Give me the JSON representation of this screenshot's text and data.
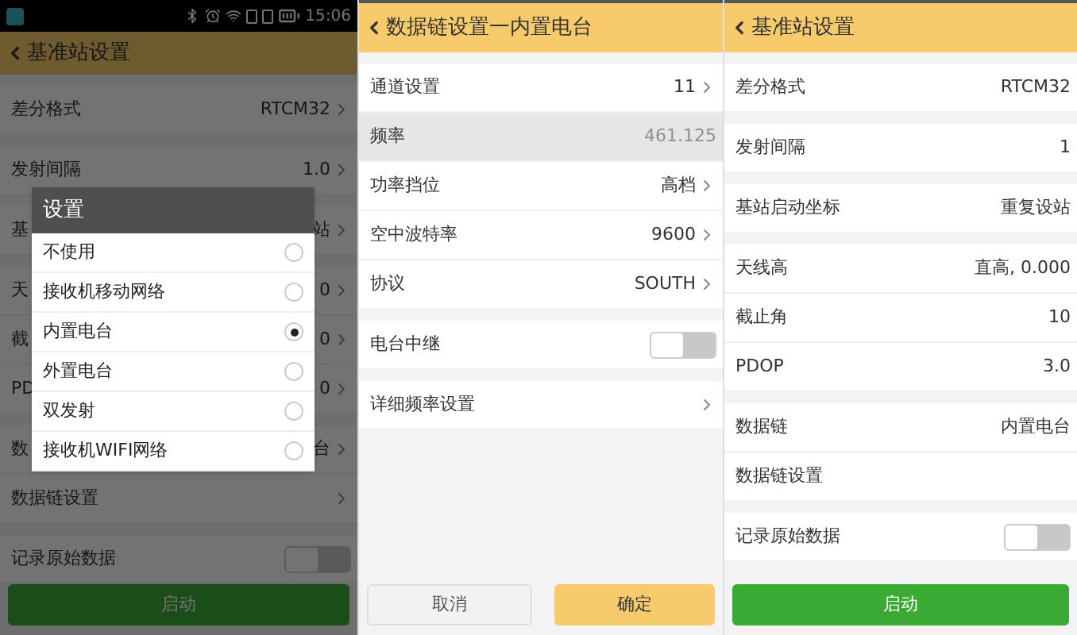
{
  "left_screen": {
    "status_bar": {
      "time": "15:06"
    },
    "title": "基准站设置",
    "groups": [
      [
        {
          "kind": "value",
          "label": "差分格式",
          "value": "RTCM32",
          "chevron": true
        }
      ],
      [
        {
          "kind": "value",
          "label": "发射间隔",
          "value": "1.0",
          "chevron": true
        }
      ],
      [
        {
          "kind": "value",
          "label": "基",
          "value": "站",
          "chevron": true
        }
      ],
      [
        {
          "kind": "value",
          "label": "天",
          "value": "0",
          "chevron": true
        },
        {
          "kind": "value",
          "label": "截",
          "value": "0",
          "chevron": true
        },
        {
          "kind": "value",
          "label": "PD",
          "value": "0",
          "chevron": true
        }
      ],
      [
        {
          "kind": "value",
          "label": "数",
          "value": "台",
          "chevron": true
        },
        {
          "kind": "value",
          "label": "数据链设置",
          "chevron": true
        }
      ],
      [
        {
          "kind": "toggle",
          "label": "记录原始数据",
          "on": false
        }
      ]
    ],
    "buttons": [
      {
        "label": "启动",
        "kind": "primary"
      }
    ],
    "dialog": {
      "title": "设置",
      "options": [
        {
          "label": "不使用",
          "selected": false
        },
        {
          "label": "接收机移动网络",
          "selected": false
        },
        {
          "label": "内置电台",
          "selected": true
        },
        {
          "label": "外置电台",
          "selected": false
        },
        {
          "label": "双发射",
          "selected": false
        },
        {
          "label": "接收机WIFI网络",
          "selected": false
        }
      ]
    }
  },
  "middle_screen": {
    "title": "数据链设置一内置电台",
    "groups": [
      [
        {
          "kind": "value",
          "label": "通道设置",
          "value": "11",
          "chevron": true
        },
        {
          "kind": "readonly",
          "label": "频率",
          "value": "461.125",
          "chevron": false
        },
        {
          "kind": "value",
          "label": "功率挡位",
          "value": "高档",
          "chevron": true
        },
        {
          "kind": "value",
          "label": "空中波特率",
          "value": "9600",
          "chevron": true
        },
        {
          "kind": "value",
          "label": "协议",
          "value": "SOUTH",
          "chevron": true
        }
      ],
      [
        {
          "kind": "toggle",
          "label": "电台中继",
          "on": false
        }
      ],
      [
        {
          "kind": "value",
          "label": "详细频率设置",
          "chevron": true
        }
      ]
    ],
    "buttons": [
      {
        "label": "取消",
        "kind": "secondary"
      },
      {
        "label": "确定",
        "kind": "accent"
      }
    ]
  },
  "right_screen": {
    "title": "基准站设置",
    "groups": [
      [
        {
          "kind": "value",
          "label": "差分格式",
          "value": "RTCM32",
          "chevron": false
        }
      ],
      [
        {
          "kind": "value",
          "label": "发射间隔",
          "value": "1",
          "chevron": false
        }
      ],
      [
        {
          "kind": "value",
          "label": "基站启动坐标",
          "value": "重复设站",
          "chevron": false
        }
      ],
      [
        {
          "kind": "value",
          "label": "天线高",
          "value": "直高, 0.000",
          "chevron": false
        },
        {
          "kind": "value",
          "label": "截止角",
          "value": "10",
          "chevron": false
        },
        {
          "kind": "value",
          "label": "PDOP",
          "value": "3.0",
          "chevron": false
        }
      ],
      [
        {
          "kind": "value",
          "label": "数据链",
          "value": "内置电台",
          "chevron": false
        },
        {
          "kind": "value",
          "label": "数据链设置",
          "chevron": false
        }
      ],
      [
        {
          "kind": "toggle",
          "label": "记录原始数据",
          "on": false
        }
      ]
    ],
    "buttons": [
      {
        "label": "启动",
        "kind": "primary"
      }
    ]
  }
}
